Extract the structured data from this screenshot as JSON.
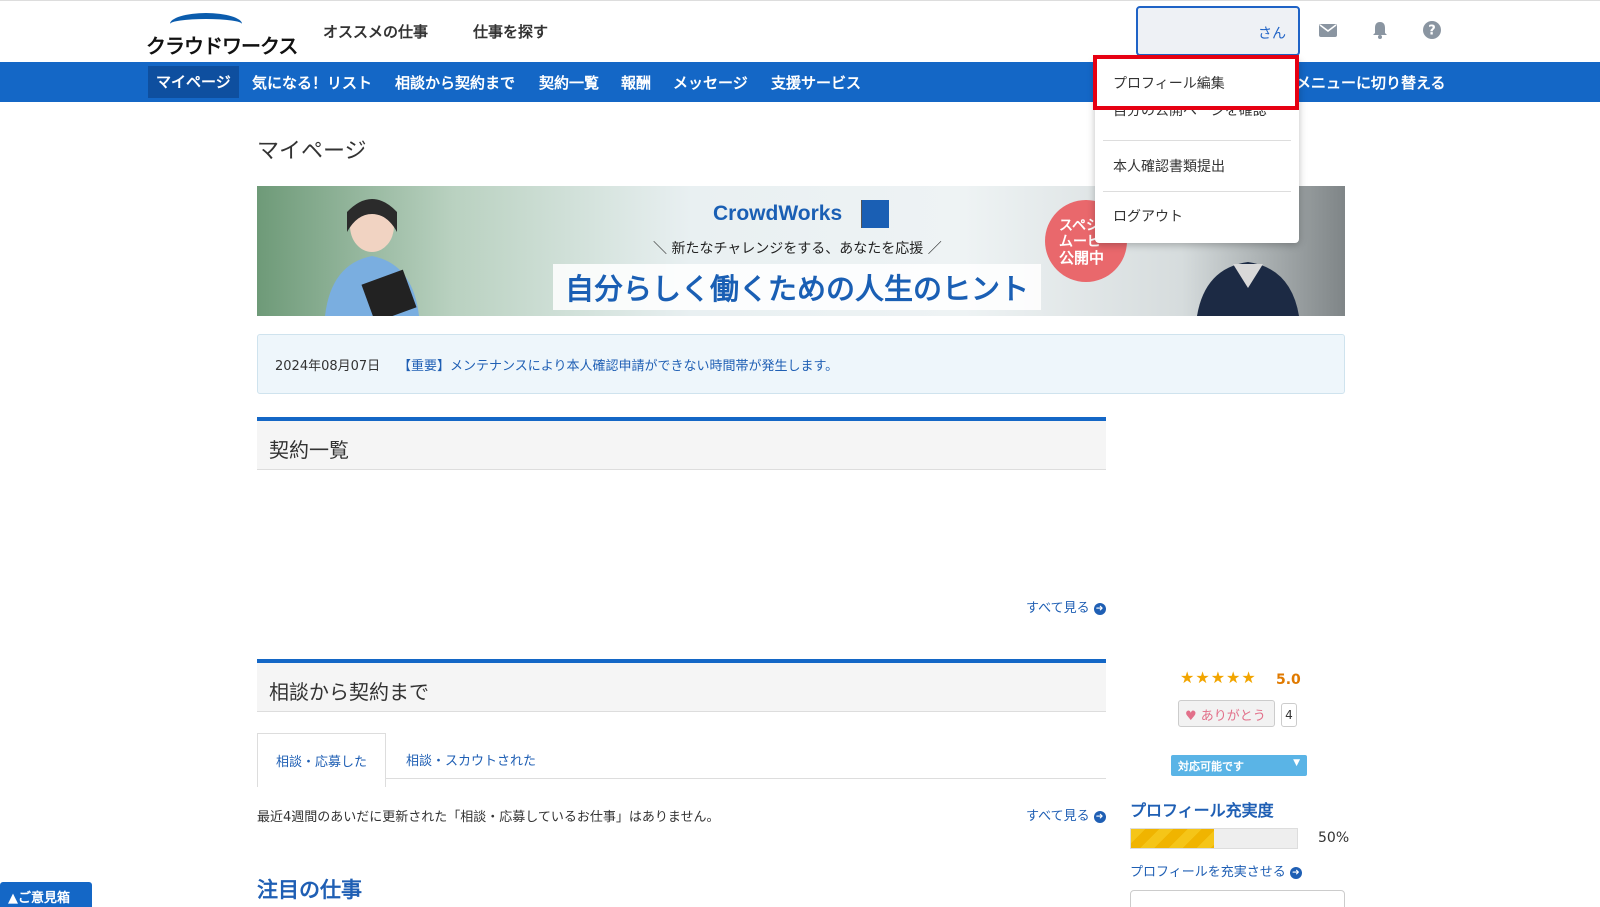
{
  "header": {
    "logo_text": "クラウドワークス",
    "nav": [
      "オススメの仕事",
      "仕事を探す"
    ],
    "user_suffix": "さん"
  },
  "bluenav": {
    "items": [
      "マイページ",
      "気になる！リスト",
      "相談から契約まで",
      "契約一覧",
      "報酬",
      "メッセージ",
      "支援サービス"
    ],
    "switch_label": "メニューに切り替える"
  },
  "dropdown": {
    "items": [
      "プロフィール編集",
      "自分の公開ページを確認",
      "本人確認書類提出",
      "ログアウト"
    ]
  },
  "page_title": "マイページ",
  "banner": {
    "brand": "CrowdWorks",
    "subtitle": "＼ 新たなチャレンジをする、あなたを応援 ／",
    "headline": "自分らしく働くための人生のヒント",
    "badge_line1": "スペシャル",
    "badge_line2": "ムービー",
    "badge_line3": "公開中"
  },
  "notice": {
    "date": "2024年08月07日",
    "text": "【重要】メンテナンスにより本人確認申請ができない時間帯が発生します。"
  },
  "contracts": {
    "title": "契約一覧",
    "see_all": "すべて見る"
  },
  "consult": {
    "title": "相談から契約まで",
    "tabs": [
      "相談・応募した",
      "相談・スカウトされた"
    ],
    "empty": "最近4週間のあいだに更新された「相談・応募しているお仕事」はありません。",
    "see_all": "すべて見る"
  },
  "featured_title": "注目の仕事",
  "profile": {
    "stars": "★★★★★",
    "rating": "5.0",
    "thanks_label": "ありがとう",
    "thanks_count": "4",
    "availability": "対応可能です",
    "completeness_title": "プロフィール充実度",
    "completeness_pct": "50%",
    "completeness_value": 0.5,
    "fill_link": "プロフィールを充実させる"
  },
  "feedback_label": "▲ご意見箱",
  "colors": {
    "brand_blue": "#1467c6",
    "link_blue": "#1f5fb4",
    "highlight_red": "#e60012"
  }
}
